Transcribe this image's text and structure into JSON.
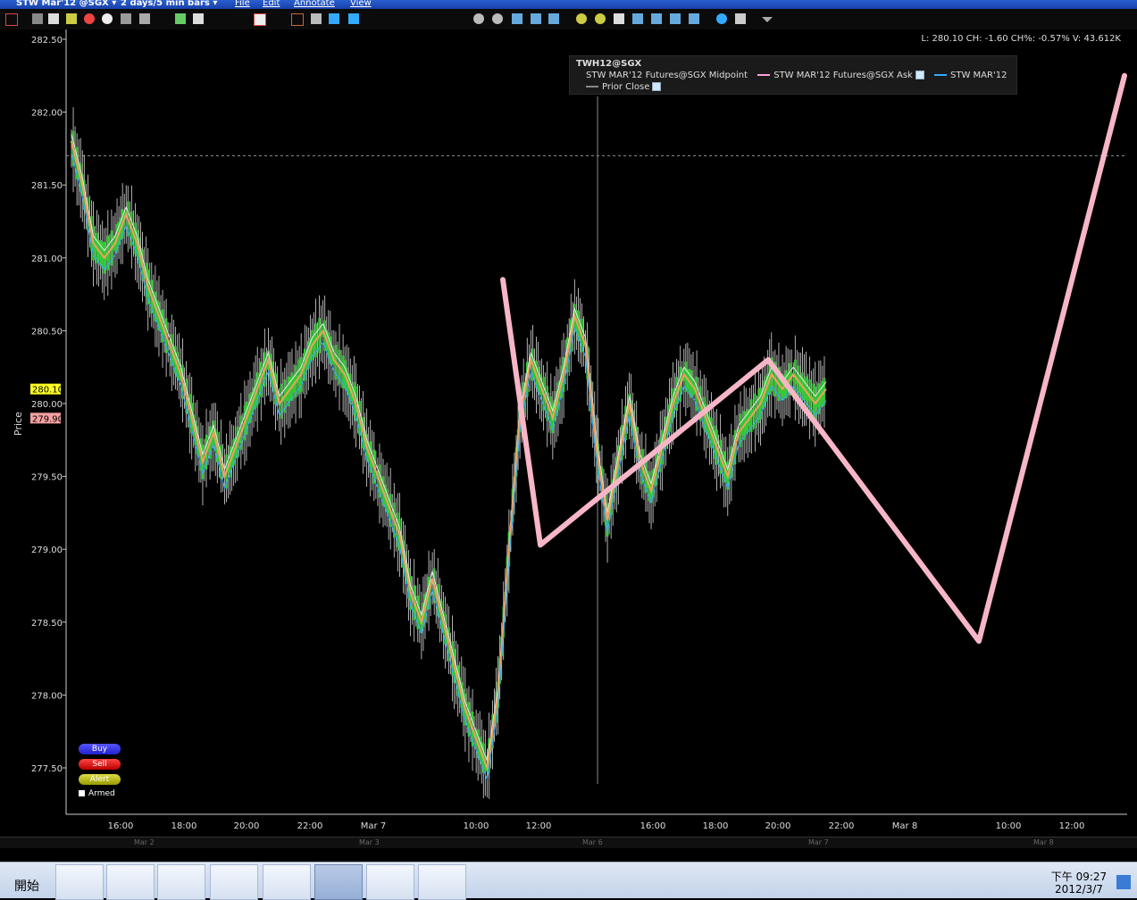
{
  "titlebar": {
    "symbol": "STW Mar'12 @SGX ▾",
    "period": "2 days/5 min bars ▾",
    "menus": [
      "File",
      "Edit",
      "Annotate",
      "View"
    ]
  },
  "infobar": {
    "text": "L: 280.10 CH: -1.60 CH%: -0.57% V: 43.612K"
  },
  "legend": {
    "title": "TWH12@SGX",
    "series1": "STW MAR'12 Futures@SGX Midpoint",
    "series2": "STW MAR'12 Futures@SGX Ask",
    "series3": "STW MAR'12",
    "series4": "Prior Close",
    "colors": {
      "midpoint": "#aaaaaa",
      "ask": "#ff9fe0",
      "series3": "#33aaff",
      "prior": "#888888"
    }
  },
  "side": {
    "buy": "Buy",
    "sell": "Sell",
    "alert": "Alert",
    "armed": "Armed"
  },
  "scroll": {
    "labels": [
      "Mar 2",
      "Mar 3",
      "Mar 6",
      "Mar 7",
      "Mar 8"
    ]
  },
  "taskbar": {
    "start": "開始",
    "time": "下午 09:27",
    "date": "2012/3/7"
  },
  "chart_data": {
    "type": "line",
    "title": "",
    "ylabel": "Price",
    "yticks": [
      282.5,
      282.0,
      281.5,
      281.0,
      280.5,
      280.0,
      279.5,
      279.0,
      278.5,
      278.0,
      277.5
    ],
    "ylim": [
      277.2,
      282.6
    ],
    "xticks": [
      "16:00",
      "18:00",
      "20:00",
      "22:00",
      "Mar 7",
      "10:00",
      "12:00",
      "16:00",
      "18:00",
      "20:00",
      "22:00",
      "Mar 8",
      "10:00",
      "12:00"
    ],
    "last_price": "280.10",
    "prior_close": "279.90",
    "price_series": [
      281.8,
      281.5,
      281.1,
      281.0,
      281.1,
      281.3,
      281.1,
      280.8,
      280.6,
      280.4,
      280.2,
      279.9,
      279.6,
      279.8,
      279.5,
      279.7,
      279.9,
      280.1,
      280.3,
      280.0,
      280.1,
      280.2,
      280.4,
      280.5,
      280.3,
      280.2,
      280.0,
      279.7,
      279.5,
      279.3,
      279.1,
      278.7,
      278.5,
      278.8,
      278.5,
      278.2,
      277.9,
      277.7,
      277.5,
      278.0,
      279.0,
      279.9,
      280.3,
      280.1,
      279.9,
      280.2,
      280.6,
      280.4,
      279.7,
      279.2,
      279.6,
      280.0,
      279.6,
      279.4,
      279.7,
      280.0,
      280.2,
      280.1,
      279.9,
      279.7,
      279.5,
      279.8,
      279.9,
      280.0,
      280.2,
      280.1,
      280.2,
      280.1,
      280.0,
      280.1
    ],
    "annotation_path": [
      [
        10.9,
        280.85
      ],
      [
        12.0,
        279.03
      ],
      [
        19.7,
        280.3
      ],
      [
        27.7,
        278.37
      ],
      [
        30.0,
        282.25
      ]
    ]
  }
}
